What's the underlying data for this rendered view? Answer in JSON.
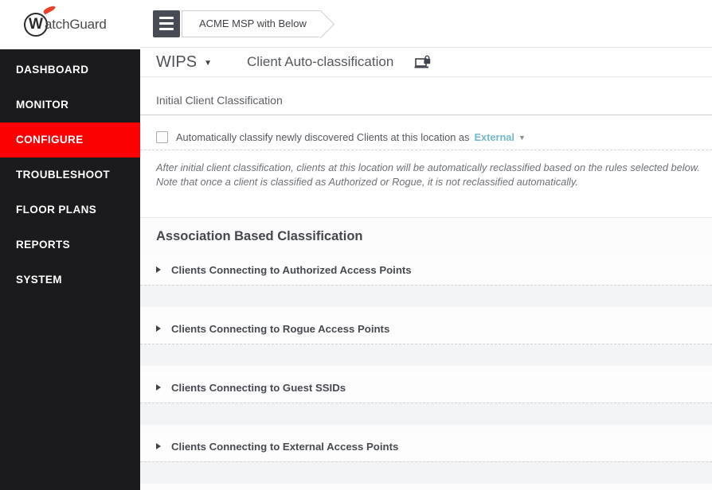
{
  "sidebar": {
    "logo": {
      "brand_w": "W",
      "brand_rest": "atchGuard"
    },
    "items": [
      {
        "label": "DASHBOARD",
        "active": false
      },
      {
        "label": "MONITOR",
        "active": false
      },
      {
        "label": "CONFIGURE",
        "active": true
      },
      {
        "label": "TROUBLESHOOT",
        "active": false
      },
      {
        "label": "FLOOR PLANS",
        "active": false
      },
      {
        "label": "REPORTS",
        "active": false
      },
      {
        "label": "SYSTEM",
        "active": false
      }
    ],
    "colors": {
      "background": "#1b1b1d",
      "active_item": "#fb0101",
      "text": "#ffffff"
    }
  },
  "topbar": {
    "breadcrumb": "ACME MSP with Below ..."
  },
  "header": {
    "module": "WIPS",
    "title": "Client Auto-classification"
  },
  "icons": {
    "module_caret": "▼",
    "dropdown_caret": "▼",
    "rule_caret": "right-triangle",
    "title_icon": "laptop-with-padlock",
    "menu_icon": "hamburger"
  },
  "initial_section": {
    "title": "Initial Client Classification",
    "checkbox_checked": false,
    "checkbox_label": "Automatically classify newly discovered Clients at this location as",
    "dropdown_value": "External",
    "dropdown_color": "#74b7cb",
    "note_line1": "After initial client classification, clients at this location will be automatically reclassified based on the rules selected below.",
    "note_line2": "Note that once a client is classified as Authorized or Rogue, it is not reclassified automatically."
  },
  "association_section": {
    "heading": "Association Based Classification",
    "rules": [
      {
        "label": "Clients Connecting to Authorized Access Points"
      },
      {
        "label": "Clients Connecting to Rogue Access Points"
      },
      {
        "label": "Clients Connecting to Guest SSIDs"
      },
      {
        "label": "Clients Connecting to External Access Points"
      }
    ]
  }
}
